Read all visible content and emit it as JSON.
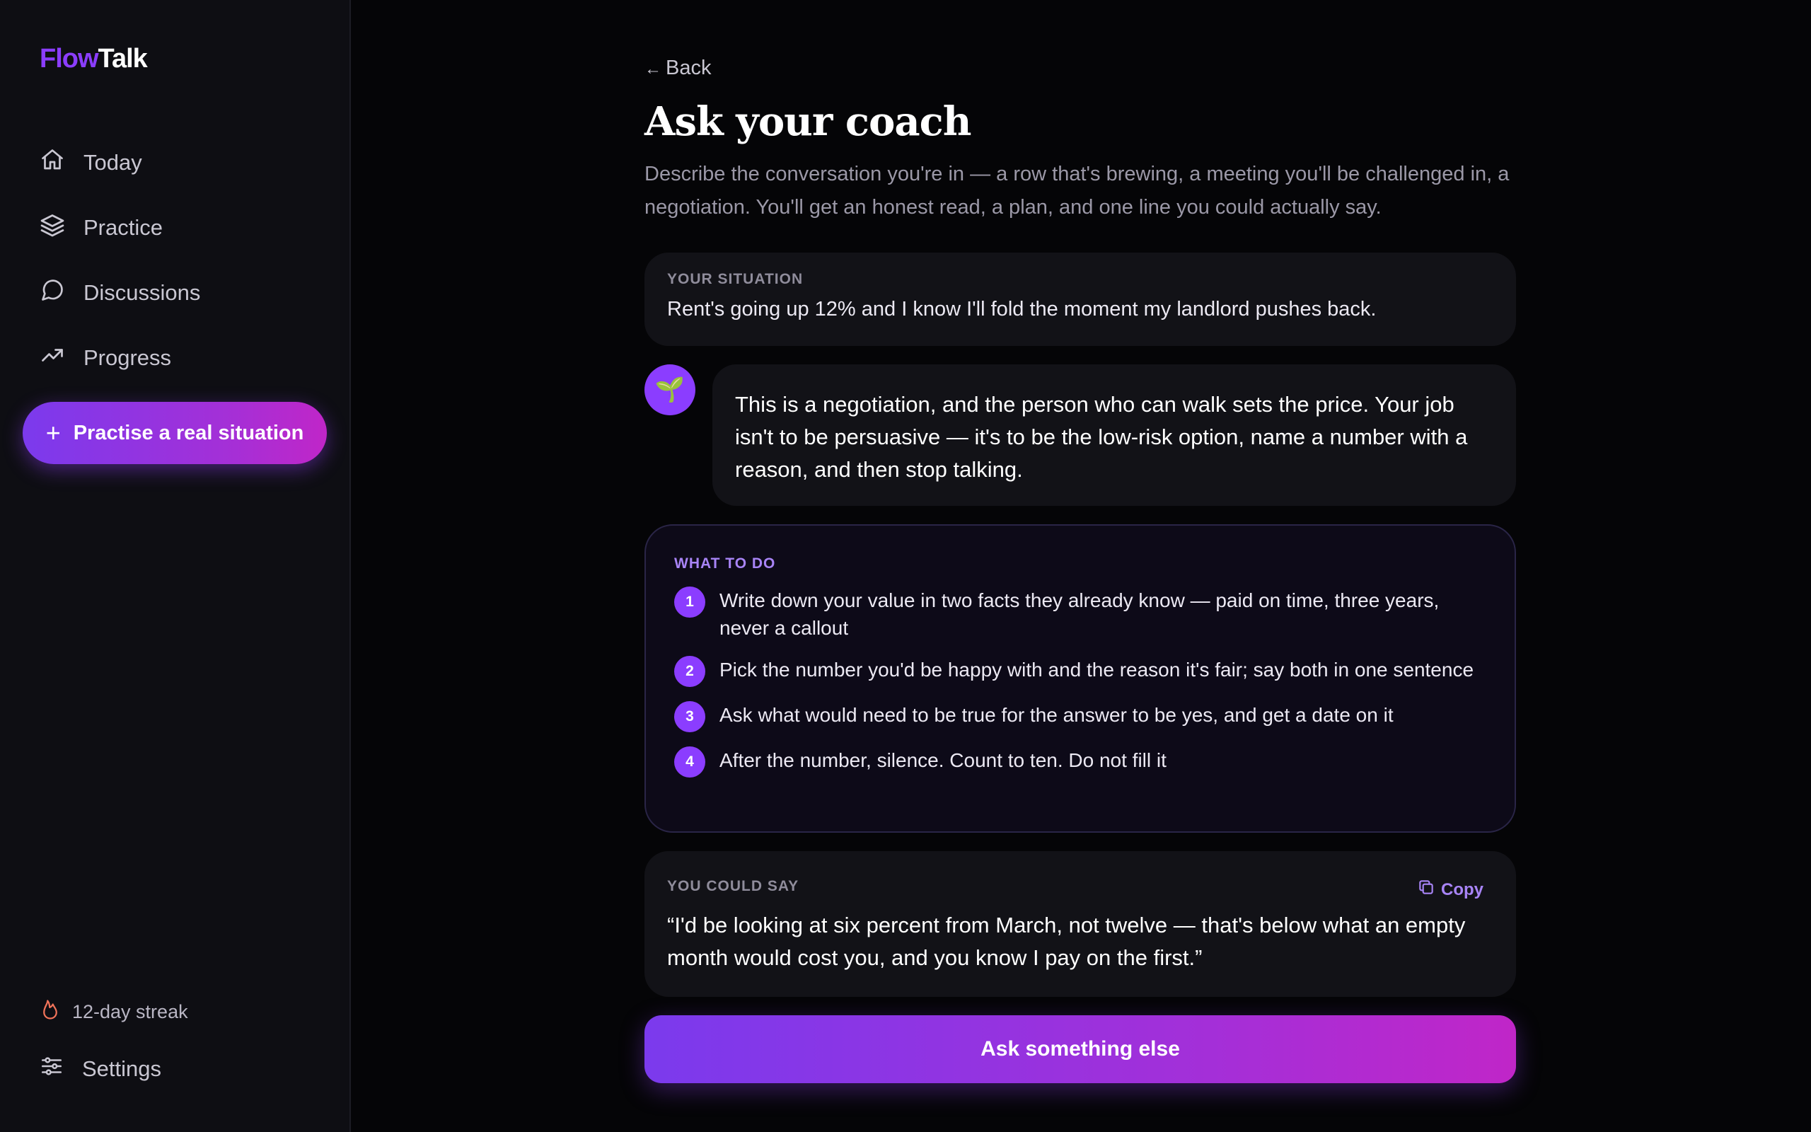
{
  "app": {
    "logo_part1": "Flow",
    "logo_part2": "Talk",
    "brand_color": "#8b3dff"
  },
  "sidebar": {
    "items": [
      {
        "label": "Today",
        "icon": "home-icon"
      },
      {
        "label": "Practice",
        "icon": "layers-icon"
      },
      {
        "label": "Discussions",
        "icon": "chat-bubble-icon"
      },
      {
        "label": "Progress",
        "icon": "trending-up-icon"
      }
    ],
    "cta_icon": "+",
    "cta_label": "Practise a real situation",
    "streak_label": "12-day streak",
    "settings_label": "Settings"
  },
  "main": {
    "back_arrow": "←",
    "back_label": "Back",
    "title": "Ask your coach",
    "subtitle": "Describe the conversation you're in — a row that's brewing, a meeting you'll be challenged in, a negotiation. You'll get an honest read, a plan, and one line you could actually say.",
    "situation": {
      "label": "YOUR SITUATION",
      "text": "Rent's going up 12% and I know I'll fold the moment my landlord pushes back."
    },
    "coach": {
      "avatar_emoji": "🌱",
      "reply": "This is a negotiation, and the person who can walk sets the price. Your job isn't to be persuasive — it's to be the low-risk option, name a number with a reason, and then stop talking."
    },
    "plan": {
      "label": "WHAT TO DO",
      "steps": [
        {
          "num": "1",
          "text": "Write down your value in two facts they already know — paid on time, three years, never a callout"
        },
        {
          "num": "2",
          "text": "Pick the number you'd be happy with and the reason it's fair; say both in one sentence"
        },
        {
          "num": "3",
          "text": "Ask what would need to be true for the answer to be yes, and get a date on it"
        },
        {
          "num": "4",
          "text": "After the number, silence. Count to ten. Do not fill it"
        }
      ]
    },
    "say": {
      "label": "YOU COULD SAY",
      "copy_label": "Copy",
      "quote": "“I'd be looking at six percent from March, not twelve — that's below what an empty month would cost you, and you know I pay on the first.”"
    },
    "cta_label": "Ask something else"
  }
}
